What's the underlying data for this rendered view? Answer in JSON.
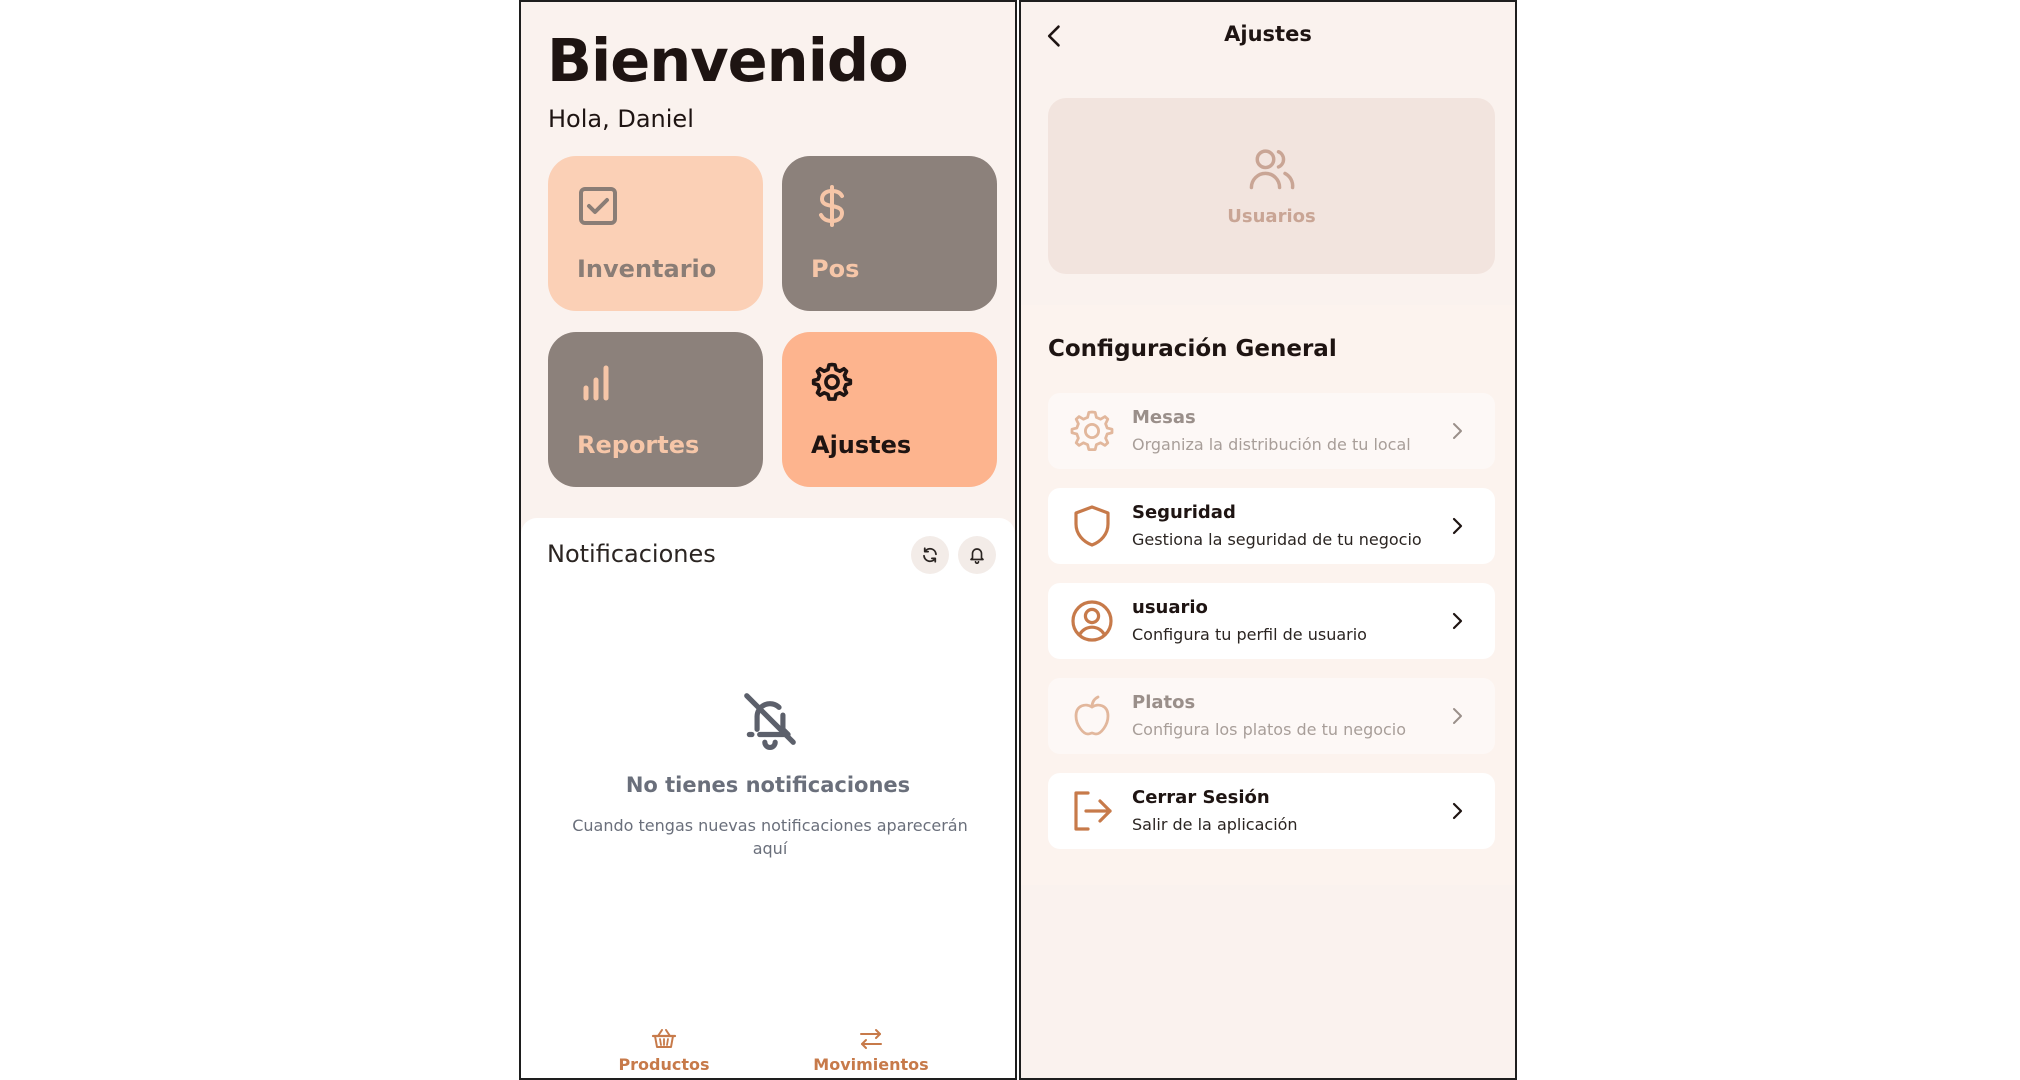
{
  "home": {
    "title": "Bienvenido",
    "greeting": "Hola, Daniel",
    "tiles": [
      {
        "label": "Inventario",
        "icon": "checkbox-icon"
      },
      {
        "label": "Pos",
        "icon": "dollar-icon"
      },
      {
        "label": "Reportes",
        "icon": "bar-chart-icon"
      },
      {
        "label": "Ajustes",
        "icon": "gear-icon"
      }
    ],
    "notifications": {
      "title": "Notificaciones",
      "empty_title": "No tienes notificaciones",
      "empty_text": "Cuando tengas nuevas notificaciones aparecerán aquí"
    },
    "bottom_nav": [
      {
        "label": "Productos",
        "icon": "basket-icon"
      },
      {
        "label": "Movimientos",
        "icon": "arrows-exchange-icon"
      }
    ]
  },
  "settings": {
    "title": "Ajustes",
    "users_card_label": "Usuarios",
    "section_title": "Configuración General",
    "items": [
      {
        "title": "Mesas",
        "subtitle": "Organiza la distribución de tu local",
        "icon": "gear-icon",
        "enabled": false
      },
      {
        "title": "Seguridad",
        "subtitle": "Gestiona la seguridad de tu negocio",
        "icon": "shield-icon",
        "enabled": true
      },
      {
        "title": "usuario",
        "subtitle": "Configura tu perfil de usuario",
        "icon": "user-circle-icon",
        "enabled": true
      },
      {
        "title": "Platos",
        "subtitle": "Configura los platos de tu negocio",
        "icon": "apple-icon",
        "enabled": false
      },
      {
        "title": "Cerrar Sesión",
        "subtitle": "Salir de la aplicación",
        "icon": "logout-icon",
        "enabled": true
      }
    ]
  },
  "colors": {
    "accent_orange": "#c77a4a",
    "tile_peach": "#fbd0b6",
    "tile_gray": "#8c817b",
    "tile_orange": "#fdb48e",
    "background": "#faf2ee"
  }
}
